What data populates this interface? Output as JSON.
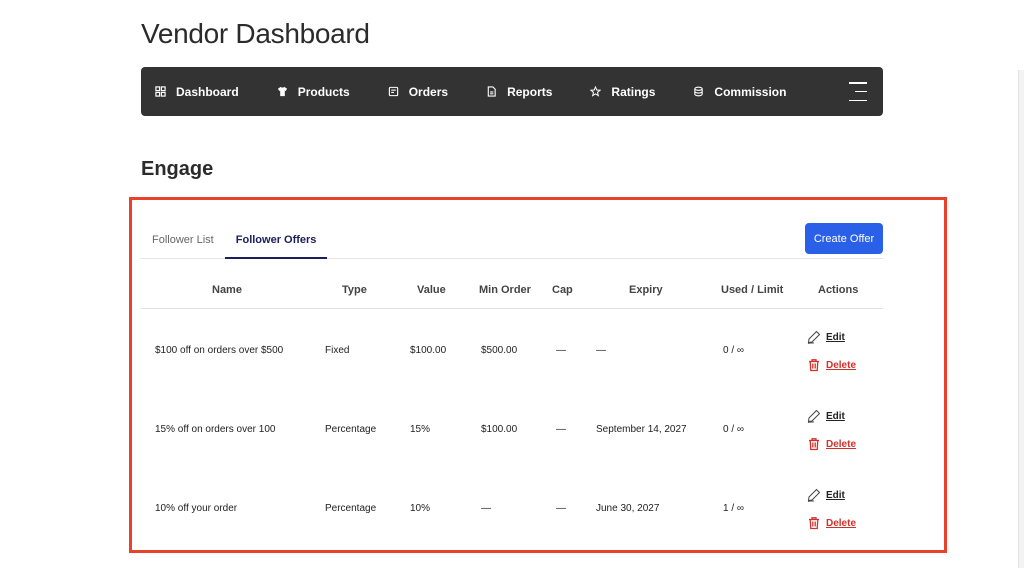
{
  "page": {
    "title": "Vendor Dashboard"
  },
  "navbar": {
    "items": [
      {
        "label": "Dashboard",
        "icon": "dashboard-icon"
      },
      {
        "label": "Products",
        "icon": "shirt-icon"
      },
      {
        "label": "Orders",
        "icon": "orders-icon"
      },
      {
        "label": "Reports",
        "icon": "report-icon"
      },
      {
        "label": "Ratings",
        "icon": "star-icon"
      },
      {
        "label": "Commission",
        "icon": "commission-icon"
      }
    ],
    "menu_icon": "hamburger-menu-icon"
  },
  "section": {
    "title": "Engage"
  },
  "tabs": [
    {
      "label": "Follower List",
      "active": false
    },
    {
      "label": "Follower Offers",
      "active": true
    }
  ],
  "create_button": {
    "label": "Create Offer"
  },
  "table": {
    "headers": {
      "name": "Name",
      "type": "Type",
      "value": "Value",
      "min_order": "Min Order",
      "cap": "Cap",
      "expiry": "Expiry",
      "used_limit": "Used / Limit",
      "actions": "Actions"
    },
    "rows": [
      {
        "name": "$100 off on orders over $500",
        "type": "Fixed",
        "value": "$100.00",
        "min_order": "$500.00",
        "cap": "—",
        "expiry": "—",
        "used_limit": "0 / ∞"
      },
      {
        "name": "15% off on orders over 100",
        "type": "Percentage",
        "value": "15%",
        "min_order": "$100.00",
        "cap": "—",
        "expiry": "September 14, 2027",
        "used_limit": "0 / ∞"
      },
      {
        "name": "10% off your order",
        "type": "Percentage",
        "value": "10%",
        "min_order": "—",
        "cap": "—",
        "expiry": "June 30, 2027",
        "used_limit": "1 / ∞"
      }
    ],
    "actions": {
      "edit_label": "Edit",
      "delete_label": "Delete"
    }
  },
  "colors": {
    "navbar_bg": "#333333",
    "primary_button": "#2a5fe8",
    "active_tab": "#1b1e5b",
    "delete": "#d0322b",
    "highlight_border": "#e8432a"
  }
}
